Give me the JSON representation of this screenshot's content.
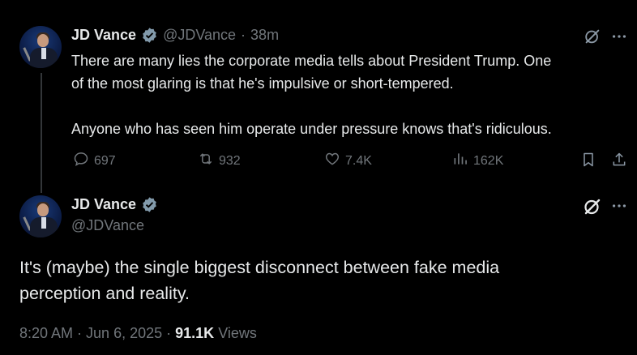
{
  "tweet1": {
    "name": "JD Vance",
    "handle": "@JDVance",
    "separator": "·",
    "time": "38m",
    "lines": [
      "There are many lies the corporate media tells about President Trump. One",
      "of the most glaring is that he's impulsive or short-tempered.",
      "Anyone who has seen him operate under pressure knows that's ridiculous."
    ],
    "actions": {
      "replies": "697",
      "reposts": "932",
      "likes": "7.4K",
      "views": "162K"
    }
  },
  "tweet2": {
    "name": "JD Vance",
    "handle": "@JDVance",
    "lines": [
      "It's (maybe) the single biggest disconnect between fake media",
      "perception and reality."
    ],
    "meta": {
      "time": "8:20 AM",
      "separator1": "·",
      "date": "Jun 6, 2025",
      "separator2": "·",
      "views_count": "91.1K",
      "views_label": "Views"
    }
  },
  "icons": [
    "verified-badge-icon",
    "grok-icon",
    "more-icon",
    "reply-icon",
    "repost-icon",
    "like-icon",
    "views-icon",
    "bookmark-icon",
    "share-icon"
  ],
  "colors": {
    "background": "#000000",
    "text": "#e7e9ea",
    "secondary": "#71767b",
    "verified": "#829aab"
  }
}
